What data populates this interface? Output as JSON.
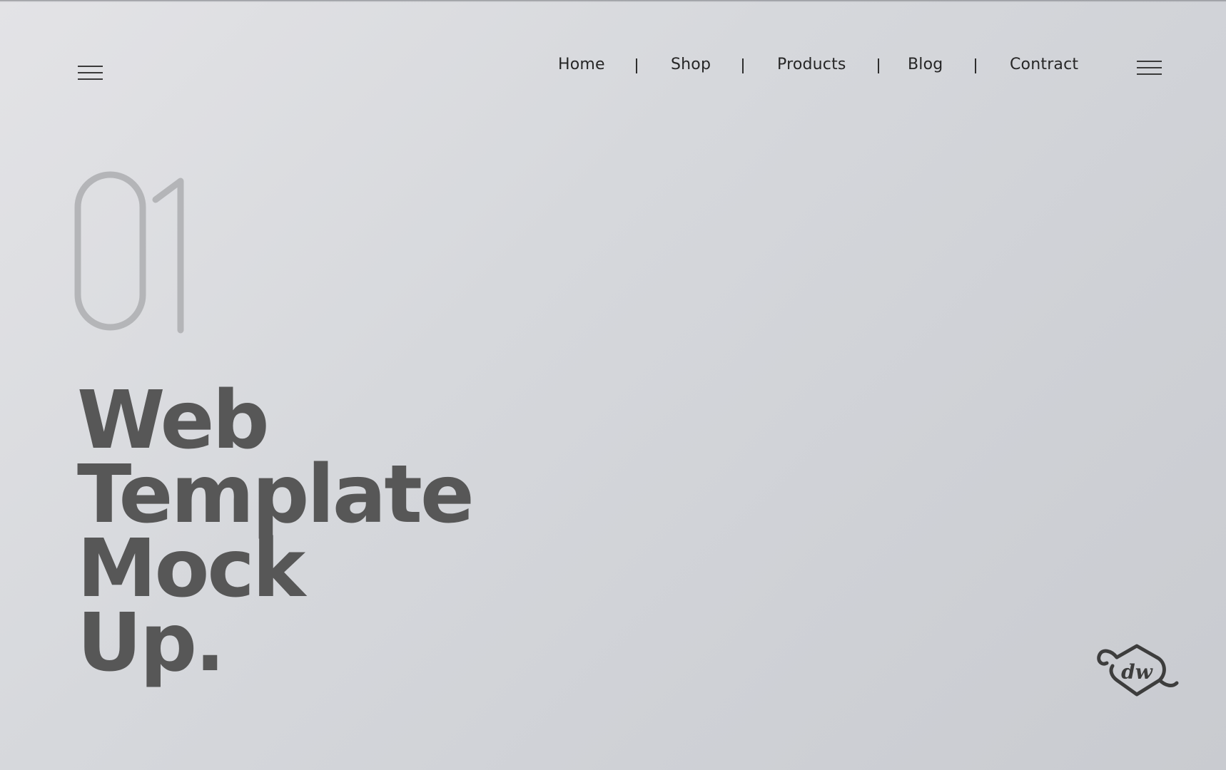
{
  "header": {
    "left_menu_icon": "hamburger-icon",
    "right_menu_icon": "hamburger-icon"
  },
  "nav": {
    "items": [
      {
        "label": "Home"
      },
      {
        "label": "Shop"
      },
      {
        "label": "Products"
      },
      {
        "label": "Blog"
      },
      {
        "label": "Contract"
      }
    ]
  },
  "hero": {
    "number": "01",
    "headline_lines": [
      "Web",
      "Template",
      "Mock",
      "Up."
    ]
  },
  "logo": {
    "text": "dw",
    "icon": "dw-monogram-logo"
  },
  "colors": {
    "background": "#d6d8dc",
    "headline": "#575757",
    "number_stroke": "#b4b5b8",
    "nav_text": "#262626"
  }
}
